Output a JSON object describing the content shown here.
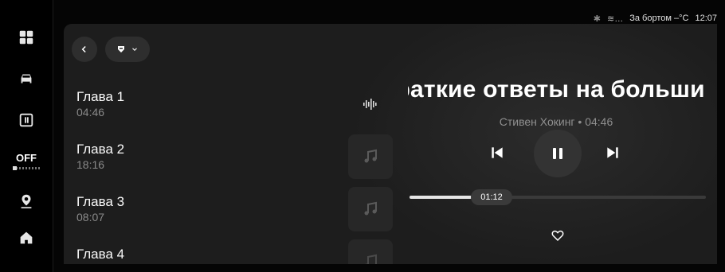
{
  "status_bar": {
    "outside_temp": "За бортом –°C",
    "clock": "12:07"
  },
  "sidebar": {
    "items": [
      {
        "icon": "apps-grid-icon"
      },
      {
        "icon": "car-icon"
      },
      {
        "icon": "calendar-icon"
      },
      {
        "label": "OFF"
      },
      {
        "icon": "location-pin-icon"
      },
      {
        "icon": "home-icon"
      }
    ]
  },
  "toolbar": {
    "back_icon": "chevron-left-icon",
    "source_icon": "source-selector-icon"
  },
  "chapters": [
    {
      "title": "Глава 1",
      "duration": "04:46"
    },
    {
      "title": "Глава 2",
      "duration": "18:16"
    },
    {
      "title": "Глава 3",
      "duration": "08:07"
    },
    {
      "title": "Глава 4",
      "duration": ""
    }
  ],
  "player": {
    "title": "Краткие ответы на большие вопросы",
    "subtitle": "Стивен Хокинг • 04:46",
    "current_time": "01:12",
    "progress": 0.21,
    "state": "playing"
  }
}
